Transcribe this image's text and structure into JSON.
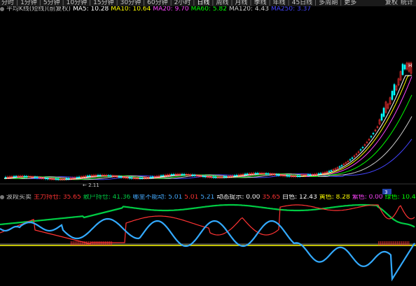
{
  "period_tabs": [
    {
      "label": "分时"
    },
    {
      "label": "1分钟"
    },
    {
      "label": "5分钟"
    },
    {
      "label": "10分钟"
    },
    {
      "label": "15分钟"
    },
    {
      "label": "30分钟"
    },
    {
      "label": "60分钟"
    },
    {
      "label": "2小时"
    },
    {
      "label": "日线"
    },
    {
      "label": "周线"
    },
    {
      "label": "月线"
    },
    {
      "label": "季线"
    },
    {
      "label": "年线"
    },
    {
      "label": "45日线"
    },
    {
      "label": "多周期"
    },
    {
      "label": "更多"
    }
  ],
  "toolbar_right": {
    "left": "复权",
    "right": "统计"
  },
  "ma_bar": {
    "title": "平均K线(短线)(前复权)",
    "items": [
      {
        "label": "MA5: 10.28",
        "color": "#ffffff"
      },
      {
        "label": "MA10: 10.64",
        "color": "#ffff00"
      },
      {
        "label": "MA20: 9.70",
        "color": "#ff44ff"
      },
      {
        "label": "MA60: 5.82",
        "color": "#00ff00"
      },
      {
        "label": "MA120: 4.43",
        "color": "#cccccc"
      },
      {
        "label": "MA250: 3.37",
        "color": "#4444ff"
      }
    ]
  },
  "price_axis": {
    "label_bottom": "2.11",
    "label_right": "3",
    "label_high": "H"
  },
  "indicator_bar": {
    "title": "波段买卖",
    "items": [
      {
        "label": "主力持仓: 35.65",
        "color": "#ff3333"
      },
      {
        "label": "散户持仓: 41.36",
        "color": "#00cc44"
      },
      {
        "label": "哪里不能动: 5.01",
        "color": "#44aaff"
      },
      {
        "label": "5.01",
        "color": "#ff3333"
      },
      {
        "label": "5.21",
        "color": "#44aaff"
      },
      {
        "label": "动态提示: 0.00",
        "color": "#ffffff"
      },
      {
        "label": "35.65",
        "color": "#ff3333"
      },
      {
        "label": "白色: 12.43",
        "color": "#ffffff"
      },
      {
        "label": "黄色: 8.28",
        "color": "#ffff00"
      },
      {
        "label": "紫色: 0.00",
        "color": "#ff44ff"
      },
      {
        "label": "绿色: 10.49",
        "color": "#00ff00"
      }
    ]
  }
}
